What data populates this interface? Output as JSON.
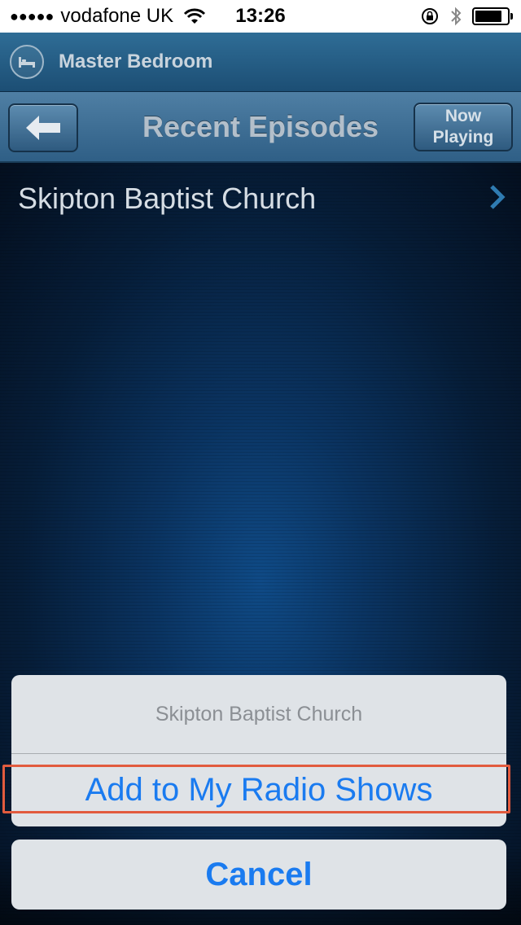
{
  "status_bar": {
    "signal_dots": "●●●●●",
    "carrier": "vodafone UK",
    "time": "13:26",
    "battery_level": 0.85,
    "icons": [
      "signal-icon",
      "wifi-icon",
      "rotation-lock-icon",
      "bluetooth-icon",
      "battery-icon"
    ]
  },
  "room": {
    "title": "Master Bedroom",
    "icon": "bed-icon"
  },
  "navbar": {
    "back_icon": "back-arrow-icon",
    "title": "Recent Episodes",
    "now_playing_line1": "Now",
    "now_playing_line2": "Playing"
  },
  "list": {
    "items": [
      {
        "label": "Skipton Baptist Church",
        "icon": "chevron-right-icon"
      }
    ]
  },
  "action_sheet": {
    "title": "Skipton Baptist Church",
    "action_label": "Add to My Radio Shows",
    "cancel_label": "Cancel"
  },
  "colors": {
    "accent": "#1a7bf0",
    "highlight_border": "#e25b3e",
    "header_blue": "#2f6d96"
  }
}
